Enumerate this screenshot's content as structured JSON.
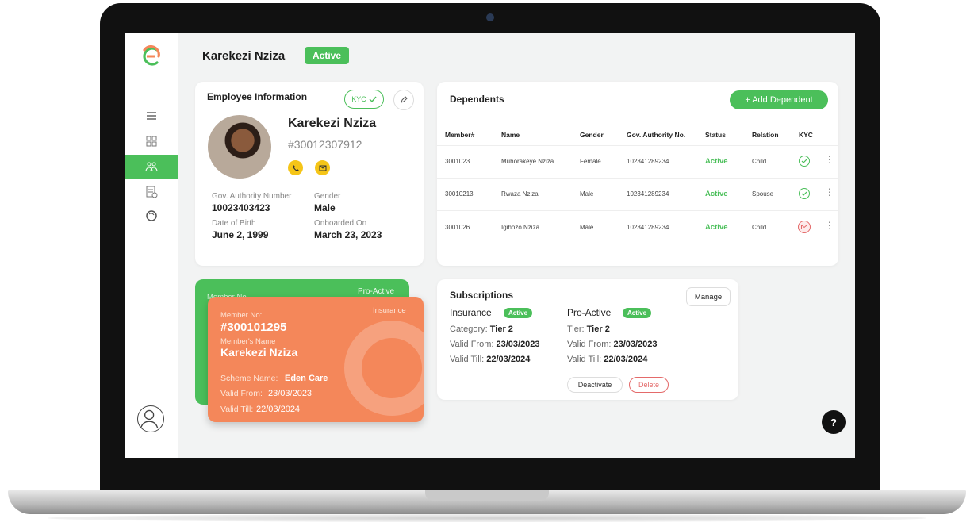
{
  "header": {
    "name": "Karekezi Nziza",
    "status": "Active"
  },
  "employee": {
    "title": "Employee Information",
    "kyc_label": "KYC",
    "name": "Karekezi Nziza",
    "id": "#30012307912",
    "fields": {
      "gov_label": "Gov. Authority Number",
      "gov_value": "10023403423",
      "gender_label": "Gender",
      "gender_value": "Male",
      "dob_label": "Date of Birth",
      "dob_value": "June 2, 1999",
      "onboard_label": "Onboarded On",
      "onboard_value": "March 23, 2023"
    }
  },
  "dependents": {
    "title": "Dependents",
    "add_label": "+ Add Dependent",
    "columns": [
      "Member#",
      "Name",
      "Gender",
      "Gov. Authority No.",
      "Status",
      "Relation",
      "KYC"
    ],
    "rows": [
      {
        "member": "3001023",
        "name": "Muhorakeye Nziza",
        "gender": "Female",
        "gov": "102341289234",
        "status": "Active",
        "relation": "Child",
        "kyc": "verified"
      },
      {
        "member": "30010213",
        "name": "Rwaza Nziza",
        "gender": "Male",
        "gov": "102341289234",
        "status": "Active",
        "relation": "Spouse",
        "kyc": "verified"
      },
      {
        "member": "3001026",
        "name": "Igihozo Nziza",
        "gender": "Male",
        "gov": "102341289234",
        "status": "Active",
        "relation": "Child",
        "kyc": "pending"
      }
    ]
  },
  "cards": {
    "back": {
      "type": "Pro-Active",
      "member_label": "Member No"
    },
    "front": {
      "type": "Insurance",
      "member_no_label": "Member No:",
      "member_no": "#300101295",
      "member_name_label": "Member's Name",
      "member_name": "Karekezi Nziza",
      "scheme_label": "Scheme Name:",
      "scheme": "Eden Care",
      "valid_from_label": "Valid From:",
      "valid_from": "23/03/2023",
      "valid_till_label": "Valid Till:",
      "valid_till": "22/03/2024"
    }
  },
  "subscriptions": {
    "title": "Subscriptions",
    "manage_label": "Manage",
    "insurance": {
      "name": "Insurance",
      "status": "Active",
      "category_label": "Category:",
      "category": "Tier 2",
      "valid_from_label": "Valid From:",
      "valid_from": "23/03/2023",
      "valid_till_label": "Valid Till:",
      "valid_till": "22/03/2024"
    },
    "proactive": {
      "name": "Pro-Active",
      "status": "Active",
      "tier_label": "Tier:",
      "tier": "Tier 2",
      "valid_from_label": "Valid From:",
      "valid_from": "23/03/2023",
      "valid_till_label": "Valid Till:",
      "valid_till": "22/03/2024"
    },
    "deactivate_label": "Deactivate",
    "delete_label": "Delete"
  },
  "help_label": "?",
  "colors": {
    "brand_green": "#4bbf5a",
    "brand_orange": "#f4875a",
    "danger": "#e46a6a"
  },
  "icons": {
    "nav": [
      "menu-icon",
      "dashboard-icon",
      "users-icon",
      "claims-icon",
      "wellness-icon"
    ],
    "user": "user-avatar-icon"
  }
}
